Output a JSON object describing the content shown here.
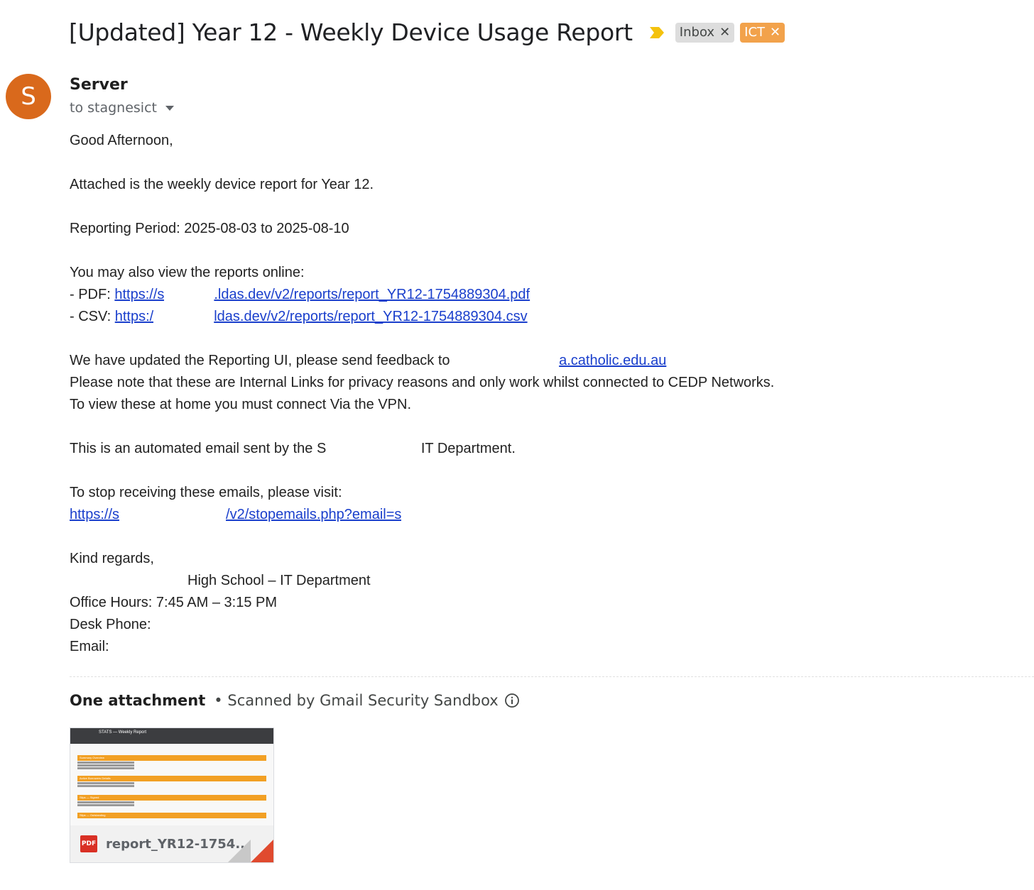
{
  "email": {
    "subject": "[Updated] Year 12 - Weekly Device Usage Report",
    "labels": [
      {
        "name": "Inbox",
        "color": "#dddddd"
      },
      {
        "name": "ICT",
        "color": "#f2a24b"
      }
    ],
    "sender": {
      "name": "Server",
      "avatar_letter": "S",
      "avatar_color": "#d9691c",
      "recipient": "to stagnesict"
    },
    "body": {
      "greeting": "Good Afternoon,",
      "intro": "Attached is the weekly device report for Year 12.",
      "period": "Reporting Period: 2025-08-03 to 2025-08-10",
      "online_intro": "You may also view the reports online:",
      "pdf_prefix": "- PDF: ",
      "pdf_link_start": "https://s",
      "pdf_link_end": ".ldas.dev/v2/reports/report_YR12-1754889304.pdf",
      "csv_prefix": "- CSV: ",
      "csv_link_start": "https:/",
      "csv_link_end": "ldas.dev/v2/reports/report_YR12-1754889304.csv",
      "feedback_text": "We have updated the Reporting UI, please send feedback to ",
      "feedback_email_end": "a.catholic.edu.au",
      "note1": "Please note that these are Internal Links for privacy reasons and only work whilst connected to CEDP Networks.",
      "note2": "To view these at home you must connect Via the VPN.",
      "automated_start": "This is an automated email sent by the S",
      "automated_end": " IT Department.",
      "stop_intro": "To stop receiving these emails, please visit:",
      "stop_link_start": "https://s",
      "stop_link_mid": "/v2/stopemails.php?email=s",
      "closing": "Kind regards,",
      "sig_school": "High School – IT Department",
      "office_hours": "Office Hours: 7:45 AM – 3:15 PM",
      "desk_phone": "Desk Phone: ",
      "email_label": "Email: "
    },
    "attachments": {
      "count_label": "One attachment",
      "scan_label": "• Scanned by Gmail Security Sandbox",
      "file": {
        "name": "report_YR12-1754...",
        "type": "PDF",
        "preview_title": "STATS — Weekly Report",
        "preview_sections": [
          "Summary Overview",
          "Active Borrowers Details",
          "Slips — Signed",
          "Slips — Outstanding"
        ]
      }
    }
  }
}
